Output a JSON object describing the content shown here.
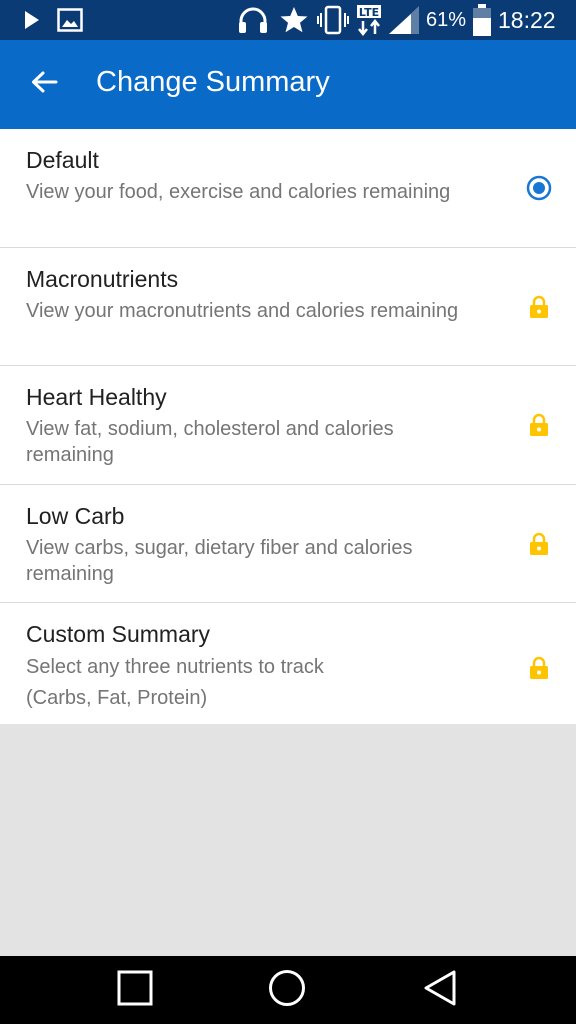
{
  "status_bar": {
    "icons": [
      "play-icon",
      "image-icon",
      "headphones-icon",
      "star-icon",
      "vibrate-icon",
      "lte-data-icon",
      "signal-icon",
      "battery-icon"
    ],
    "battery": "61%",
    "time": "18:22"
  },
  "app_bar": {
    "back_icon": "arrow-left-icon",
    "title": "Change Summary",
    "background_color": "#0a6ac8"
  },
  "options": [
    {
      "title": "Default",
      "description": "View your food, exercise and calories remaining",
      "state": "selected",
      "icon": "radio-selected-icon"
    },
    {
      "title": "Macronutrients",
      "description": "View your macronutrients and calories remaining",
      "state": "locked",
      "icon": "lock-icon"
    },
    {
      "title": "Heart Healthy",
      "description": "View fat, sodium, cholesterol and calories remaining",
      "state": "locked",
      "icon": "lock-icon"
    },
    {
      "title": "Low Carb",
      "description": "View carbs, sugar, dietary fiber and calories remaining",
      "state": "locked",
      "icon": "lock-icon"
    },
    {
      "title": "Custom Summary",
      "description": "Select any three nutrients to track\n(Carbs, Fat, Protein)",
      "state": "locked",
      "icon": "lock-icon"
    }
  ],
  "colors": {
    "accent": "#0a6ac8",
    "status_bar": "#0a3b74",
    "lock": "#ffc400",
    "radio": "#1976d2"
  },
  "nav_bar": {
    "icons": [
      "recents-square-icon",
      "home-circle-icon",
      "back-triangle-icon"
    ]
  }
}
